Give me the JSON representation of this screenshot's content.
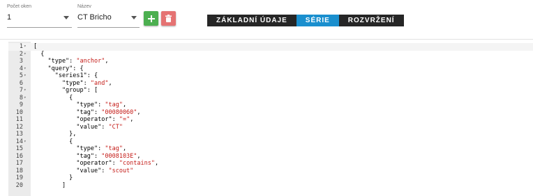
{
  "toolbar": {
    "window_count": {
      "label": "Počet oken",
      "value": "1"
    },
    "name": {
      "label": "Název",
      "value": "CT Bricho"
    },
    "add_icon": "plus-icon",
    "delete_icon": "trash-icon",
    "colors": {
      "add": "#4caf50",
      "delete": "#e57373",
      "tabs_bg": "#262626",
      "tab_active": "#1a8fce"
    },
    "tabs": [
      {
        "label": "ZÁKLADNÍ ÚDAJE",
        "active": false
      },
      {
        "label": "SÉRIE",
        "active": true
      },
      {
        "label": "ROZVRŽENÍ",
        "active": false
      }
    ]
  },
  "editor": {
    "lines": [
      {
        "n": "1",
        "fold": true,
        "parts": [
          [
            "p",
            "["
          ]
        ]
      },
      {
        "n": "2",
        "fold": true,
        "parts": [
          [
            "p",
            "  {"
          ]
        ]
      },
      {
        "n": "3",
        "fold": false,
        "parts": [
          [
            "p",
            "    \"type\": "
          ],
          [
            "s",
            "\"anchor\""
          ],
          [
            "p",
            ","
          ]
        ]
      },
      {
        "n": "4",
        "fold": true,
        "parts": [
          [
            "p",
            "    \"query\": {"
          ]
        ]
      },
      {
        "n": "5",
        "fold": true,
        "parts": [
          [
            "p",
            "      \"series1\": {"
          ]
        ]
      },
      {
        "n": "6",
        "fold": false,
        "parts": [
          [
            "p",
            "        \"type\": "
          ],
          [
            "s",
            "\"and\""
          ],
          [
            "p",
            ","
          ]
        ]
      },
      {
        "n": "7",
        "fold": true,
        "parts": [
          [
            "p",
            "        \"group\": ["
          ]
        ]
      },
      {
        "n": "8",
        "fold": true,
        "parts": [
          [
            "p",
            "          {"
          ]
        ]
      },
      {
        "n": "9",
        "fold": false,
        "parts": [
          [
            "p",
            "            \"type\": "
          ],
          [
            "s",
            "\"tag\""
          ],
          [
            "p",
            ","
          ]
        ]
      },
      {
        "n": "10",
        "fold": false,
        "parts": [
          [
            "p",
            "            \"tag\": "
          ],
          [
            "s",
            "\"00080060\""
          ],
          [
            "p",
            ","
          ]
        ]
      },
      {
        "n": "11",
        "fold": false,
        "parts": [
          [
            "p",
            "            \"operator\": "
          ],
          [
            "s",
            "\"=\""
          ],
          [
            "p",
            ","
          ]
        ]
      },
      {
        "n": "12",
        "fold": false,
        "parts": [
          [
            "p",
            "            \"value\": "
          ],
          [
            "s",
            "\"CT\""
          ]
        ]
      },
      {
        "n": "13",
        "fold": false,
        "parts": [
          [
            "p",
            "          },"
          ]
        ]
      },
      {
        "n": "14",
        "fold": true,
        "parts": [
          [
            "p",
            "          {"
          ]
        ]
      },
      {
        "n": "15",
        "fold": false,
        "parts": [
          [
            "p",
            "            \"type\": "
          ],
          [
            "s",
            "\"tag\""
          ],
          [
            "p",
            ","
          ]
        ]
      },
      {
        "n": "16",
        "fold": false,
        "parts": [
          [
            "p",
            "            \"tag\": "
          ],
          [
            "s",
            "\"0008103E\""
          ],
          [
            "p",
            ","
          ]
        ]
      },
      {
        "n": "17",
        "fold": false,
        "parts": [
          [
            "p",
            "            \"operator\": "
          ],
          [
            "s",
            "\"contains\""
          ],
          [
            "p",
            ","
          ]
        ]
      },
      {
        "n": "18",
        "fold": false,
        "parts": [
          [
            "p",
            "            \"value\": "
          ],
          [
            "s",
            "\"scout\""
          ]
        ]
      },
      {
        "n": "19",
        "fold": false,
        "parts": [
          [
            "p",
            "          }"
          ]
        ]
      },
      {
        "n": "20",
        "fold": false,
        "parts": [
          [
            "p",
            "        ]"
          ]
        ]
      }
    ]
  }
}
